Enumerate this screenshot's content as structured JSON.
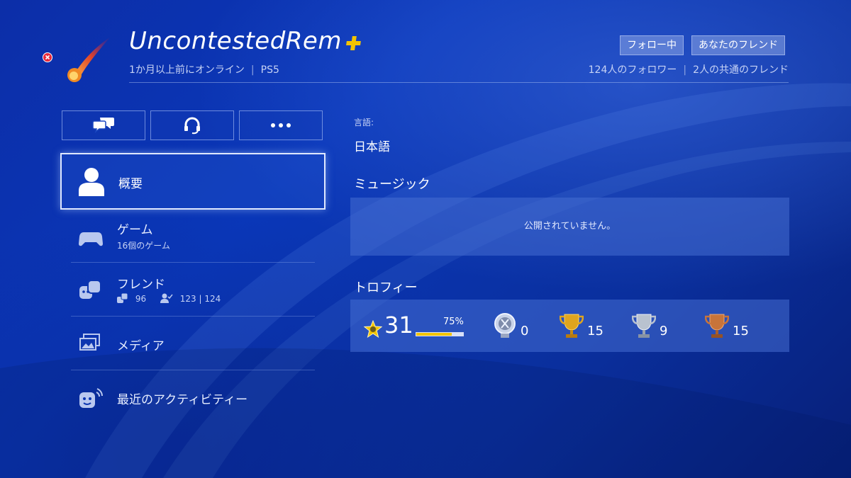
{
  "profile": {
    "username": "UncontestedRem",
    "online_status": "1か月以上前にオンライン",
    "platform": "PS5",
    "follow_label": "フォロー中",
    "friend_label": "あなたのフレンド",
    "followers": "124人のフォロワー",
    "mutual_friends": "2人の共通のフレンド"
  },
  "actions": [
    {
      "icon": "message-icon"
    },
    {
      "icon": "headset-icon"
    },
    {
      "icon": "more-icon"
    }
  ],
  "menu": {
    "overview": {
      "label": "概要",
      "icon": "person-icon"
    },
    "games": {
      "label": "ゲーム",
      "sub": "16個のゲーム",
      "icon": "controller-icon"
    },
    "friends": {
      "label": "フレンド",
      "friends_count": "96",
      "followers_count": "123 | 124",
      "icon": "friends-icon"
    },
    "media": {
      "label": "メディア",
      "icon": "media-icon"
    },
    "activity": {
      "label": "最近のアクティビティー",
      "icon": "activity-icon"
    }
  },
  "details": {
    "language_label": "言語:",
    "language_value": "日本語",
    "music_title": "ミュージック",
    "music_text": "公開されていません。",
    "trophy_title": "トロフィー"
  },
  "trophies": {
    "level": "31",
    "progress_label": "75%",
    "progress": 0.75,
    "platinum": "0",
    "gold": "15",
    "silver": "9",
    "bronze": "15"
  },
  "colors": {
    "background": "#0a37b8",
    "accent_plus": "#f3c400",
    "progress_fill": "#f3c400",
    "close_dot": "#e8283a"
  }
}
